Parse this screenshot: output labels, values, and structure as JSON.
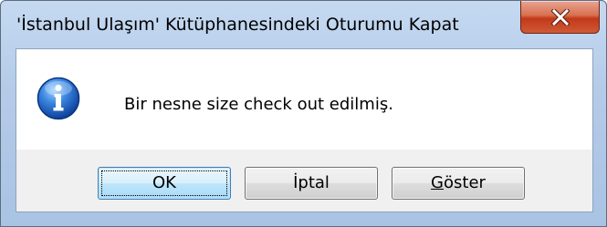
{
  "window": {
    "title": "'İstanbul Ulaşım' Kütüphanesindeki Oturumu Kapat",
    "close_icon": "close-x-icon"
  },
  "dialog": {
    "icon": "info-icon",
    "message": "Bir nesne size check out edilmiş."
  },
  "buttons": {
    "ok_label": "OK",
    "cancel_label": "İptal",
    "show_label_prefix": "",
    "show_label_underlined": "G",
    "show_label_rest": "öster"
  },
  "colors": {
    "close_button": "#c7432a",
    "info_icon": "#1e5fb8",
    "default_button_border": "#3c7fb1"
  }
}
